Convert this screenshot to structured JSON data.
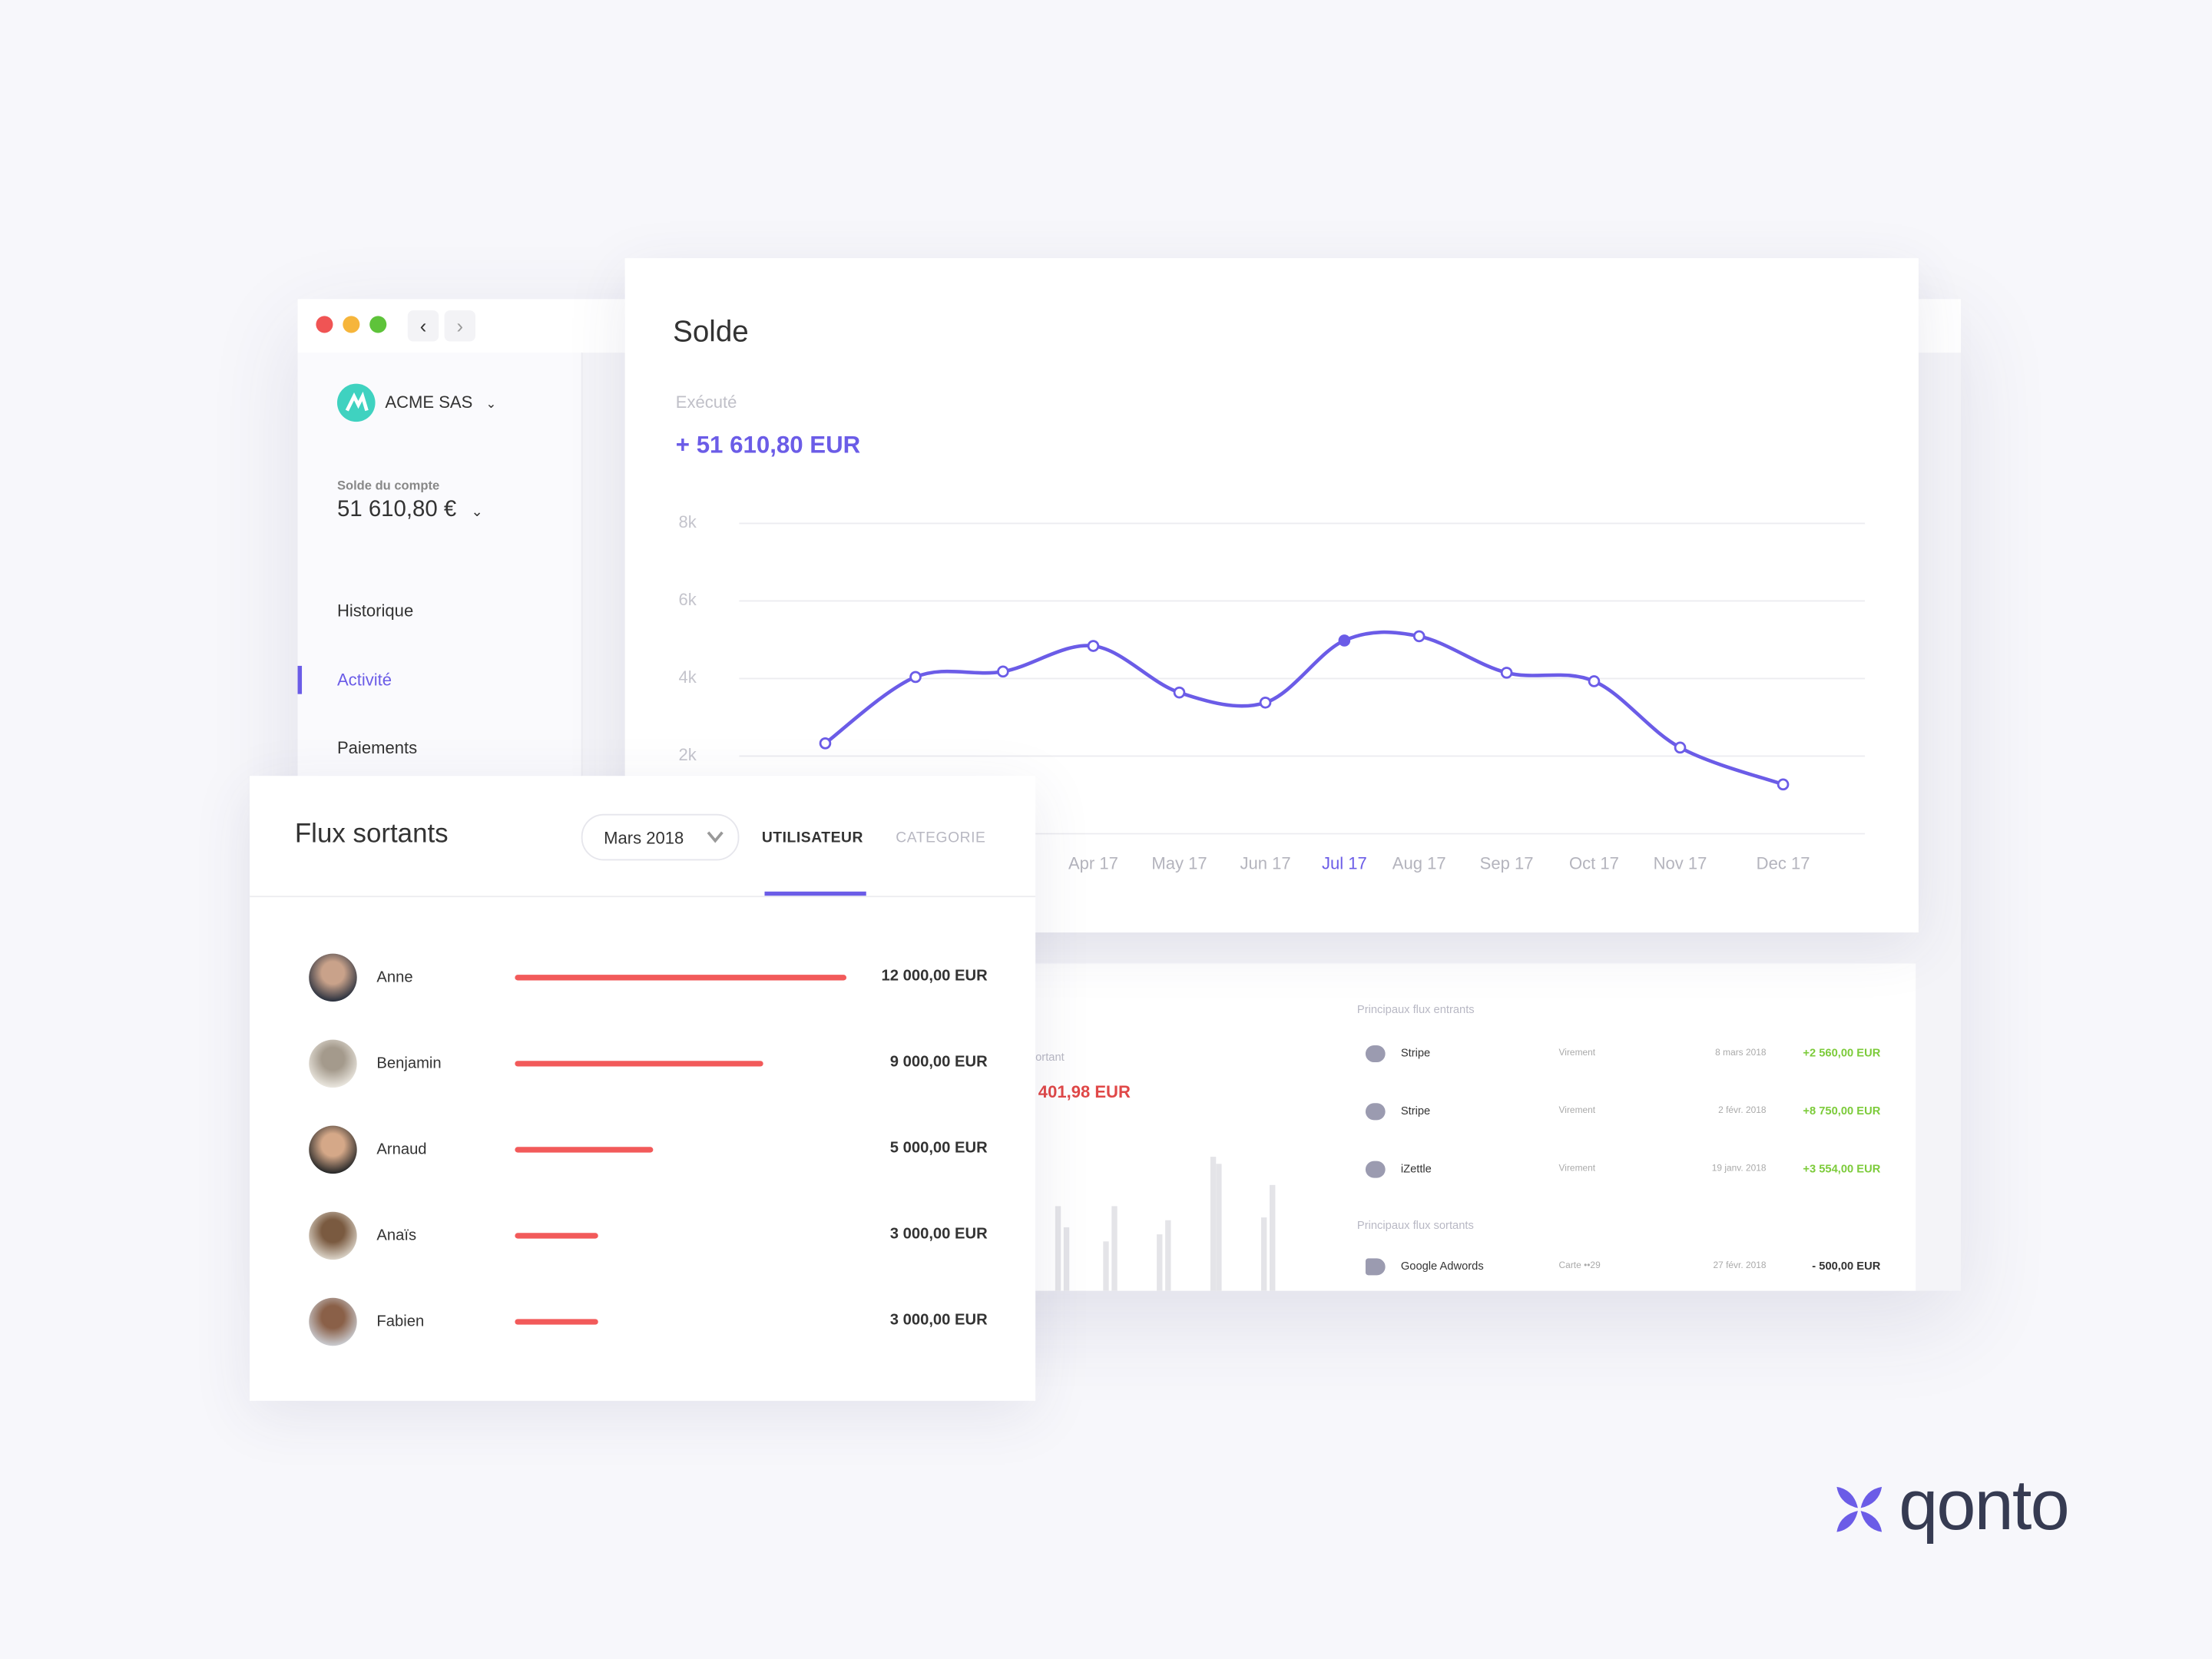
{
  "colors": {
    "accent": "#6b5ce7",
    "outflow": "#f25a5a",
    "inflow": "#7ccb3a",
    "teal": "#3fd2c0"
  },
  "window": {
    "back_icon": "chevron-left-icon",
    "forward_icon": "chevron-right-icon"
  },
  "sidebar": {
    "company": "ACME SAS",
    "balance_label": "Solde du compte",
    "balance": "51 610,80 €",
    "items": [
      {
        "label": "Historique",
        "active": false
      },
      {
        "label": "Activité",
        "active": true
      },
      {
        "label": "Paiements",
        "active": false
      }
    ]
  },
  "solde": {
    "title": "Solde",
    "status_label": "Exécuté",
    "amount": "+ 51 610,80 EUR"
  },
  "chart_data": {
    "type": "line",
    "y_ticks": [
      "2k",
      "4k",
      "6k",
      "8k"
    ],
    "ylim": [
      0,
      8000
    ],
    "grid": true,
    "categories": [
      "",
      "",
      "",
      "Apr 17",
      "May 17",
      "Jun 17",
      "Jul 17",
      "Aug 17",
      "Sep 17",
      "Oct 17",
      "Nov 17",
      "Dec 17"
    ],
    "highlighted": "Jul 17",
    "values": [
      2330,
      4040,
      4180,
      4840,
      3640,
      3380,
      4980,
      5090,
      4150,
      3930,
      2220,
      1270
    ],
    "color": "#6b5ce7"
  },
  "lower": {
    "partial_label": "ortant",
    "partial_amount": "401,98 EUR",
    "incoming_title": "Principaux flux entrants",
    "incoming": [
      {
        "icon": "handshake-icon",
        "name": "Stripe",
        "type": "Virement",
        "date": "8 mars 2018",
        "amount": "+2 560,00 EUR"
      },
      {
        "icon": "handshake-icon",
        "name": "Stripe",
        "type": "Virement",
        "date": "2 févr. 2018",
        "amount": "+8 750,00 EUR"
      },
      {
        "icon": "handshake-icon",
        "name": "iZettle",
        "type": "Virement",
        "date": "19 janv. 2018",
        "amount": "+3 554,00 EUR"
      }
    ],
    "outgoing_title": "Principaux flux sortants",
    "outgoing": [
      {
        "icon": "megaphone-icon",
        "name": "Google Adwords",
        "type": "Carte ••29",
        "date": "27 févr. 2018",
        "amount": "- 500,00 EUR"
      }
    ]
  },
  "flux": {
    "title": "Flux sortants",
    "period": "Mars 2018",
    "tabs": [
      {
        "label": "UTILISATEUR",
        "active": true
      },
      {
        "label": "CATEGORIE",
        "active": false
      }
    ],
    "rows": [
      {
        "name": "Anne",
        "value": 12000,
        "amount": "12 000,00 EUR"
      },
      {
        "name": "Benjamin",
        "value": 9000,
        "amount": "9 000,00 EUR"
      },
      {
        "name": "Arnaud",
        "value": 5000,
        "amount": "5 000,00 EUR"
      },
      {
        "name": "Anaïs",
        "value": 3000,
        "amount": "3 000,00 EUR"
      },
      {
        "name": "Fabien",
        "value": 3000,
        "amount": "3 000,00 EUR"
      }
    ]
  },
  "brand": {
    "name": "qonto"
  }
}
